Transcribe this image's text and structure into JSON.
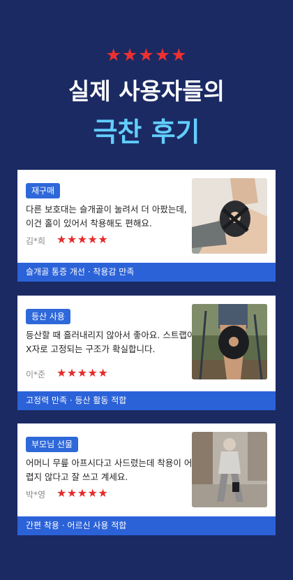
{
  "header": {
    "stars": "★★★★★",
    "title_line1": "실제 사용자들의",
    "title_line2": "극찬 후기"
  },
  "reviews": [
    {
      "badge": "재구매",
      "text": "다른 보호대는 슬개골이 눌려서 더 아팠는데, 이건 홀이 있어서 착용해도 편해요.",
      "author": "김*희",
      "rating": "★★★★★",
      "footer": "슬개골 통증 개선 · 착용감 만족",
      "photo_icon": "knee-brace-photo-yoga"
    },
    {
      "badge": "등산 사용",
      "text": "등산할 때 흘러내리지 않아서 좋아요. 스트랩이 X자로 고정되는 구조가 확실합니다.",
      "author": "이*준",
      "rating": "★★★★★",
      "footer": "고정력 만족 · 등산 활동 적합",
      "photo_icon": "knee-brace-photo-hiking"
    },
    {
      "badge": "부모님 선물",
      "text": "어머니 무릎 아프시다고 사드렸는데 착용이 어렵지 않다고 잘 쓰고 계세요.",
      "author": "박*영",
      "rating": "★★★★★",
      "footer": "간편 착용 · 어르신 사용 적합",
      "photo_icon": "knee-brace-photo-walking"
    }
  ],
  "colors": {
    "background": "#1b2a63",
    "accent_blue": "#2b62d8",
    "title_cyan": "#62cfff",
    "star_red": "#e52a2a"
  }
}
